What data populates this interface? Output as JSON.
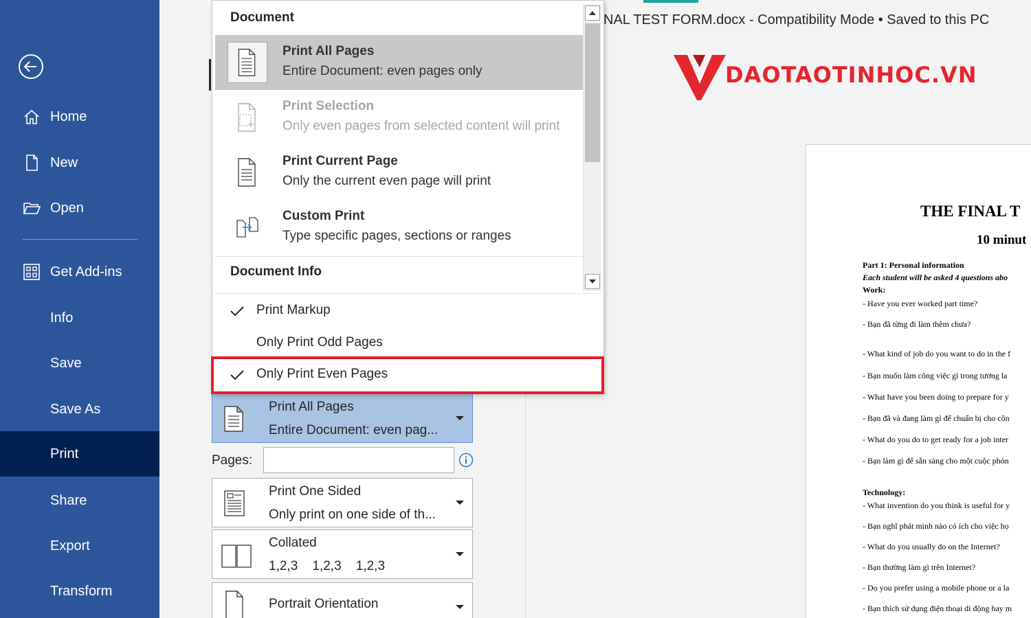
{
  "sidebar": {
    "items": [
      {
        "label": "Home",
        "icon": "home-icon"
      },
      {
        "label": "New",
        "icon": "new-document-icon"
      },
      {
        "label": "Open",
        "icon": "open-folder-icon"
      },
      {
        "label": "Get Add-ins",
        "icon": "add-ins-icon"
      },
      {
        "label": "Info"
      },
      {
        "label": "Save"
      },
      {
        "label": "Save As"
      },
      {
        "label": "Print",
        "active": true
      },
      {
        "label": "Share"
      },
      {
        "label": "Export"
      },
      {
        "label": "Transform"
      }
    ]
  },
  "titlebar": {
    "text": "NAL TEST FORM.docx  -  Compatibility Mode  •  Saved to this PC"
  },
  "watermark": {
    "text": "DAOTAOTINHOC.VN",
    "color": "#e4262f"
  },
  "menu": {
    "header_document": "Document",
    "items": [
      {
        "title": "Print All Pages",
        "desc": "Entire Document: even pages only",
        "icon": "print-all-pages-icon",
        "highlighted": true
      },
      {
        "title": "Print Selection",
        "desc": "Only even pages from selected content will print",
        "icon": "print-selection-icon",
        "disabled": true
      },
      {
        "title": "Print Current Page",
        "desc": "Only the current even page will print",
        "icon": "print-current-page-icon"
      },
      {
        "title": "Custom Print",
        "desc": "Type specific pages, sections or ranges",
        "icon": "custom-print-icon"
      }
    ],
    "header_document_info": "Document Info",
    "checks": [
      {
        "label": "Print Markup",
        "checked": true
      },
      {
        "label": "Only Print Odd Pages",
        "checked": false
      },
      {
        "label": "Only Print Even Pages",
        "checked": true
      }
    ]
  },
  "settings": {
    "pages_dropdown": {
      "line1": "Print All Pages",
      "line2": "Entire Document: even pag..."
    },
    "pages_label": "Pages:",
    "pages_value": "",
    "sides": {
      "line1": "Print One Sided",
      "line2": "Only print on one side of th..."
    },
    "collate": {
      "line1": "Collated",
      "line2": "1,2,3    1,2,3    1,2,3"
    },
    "orientation": {
      "line1": "Portrait Orientation"
    }
  },
  "document": {
    "title": "THE FINAL T",
    "subtitle": "10 minut",
    "lines": [
      {
        "text": "Part 1: Personal information",
        "style": "part"
      },
      {
        "text": "Each student will be asked 4 questions abo",
        "style": "bi"
      },
      {
        "text": "Work:",
        "style": "b"
      },
      {
        "text": "- Have you ever worked part time?",
        "style": ""
      },
      {
        "text": " - Bạn đã từng đi làm thêm chưa?",
        "style": ""
      },
      {
        "text": "- What kind of job do you want to do in the f",
        "style": ""
      },
      {
        "text": " - Bạn muốn làm công việc gì trong tương la",
        "style": ""
      },
      {
        "text": "- What have you been doing to prepare for y",
        "style": ""
      },
      {
        "text": "- Bạn đã và đang làm gì để chuẩn bị cho côn",
        "style": ""
      },
      {
        "text": "- What do you do to get ready for a job inter",
        "style": ""
      },
      {
        "text": "- Bạn làm gì để sẵn sàng cho một cuộc phỏn",
        "style": ""
      },
      {
        "text": "Technology:",
        "style": "b"
      },
      {
        "text": "- What invention do you think is useful for y",
        "style": ""
      },
      {
        "text": "- Bạn nghĩ phát minh nào có ích cho việc họ",
        "style": ""
      },
      {
        "text": "- What do you usually do on the Internet?",
        "style": ""
      },
      {
        "text": "- Bạn thường làm gì trên Internet?",
        "style": ""
      },
      {
        "text": "- Do you prefer using a mobile phone or a la",
        "style": ""
      },
      {
        "text": "- Bạn thích sử dụng điện thoại di động hay m",
        "style": ""
      }
    ]
  }
}
